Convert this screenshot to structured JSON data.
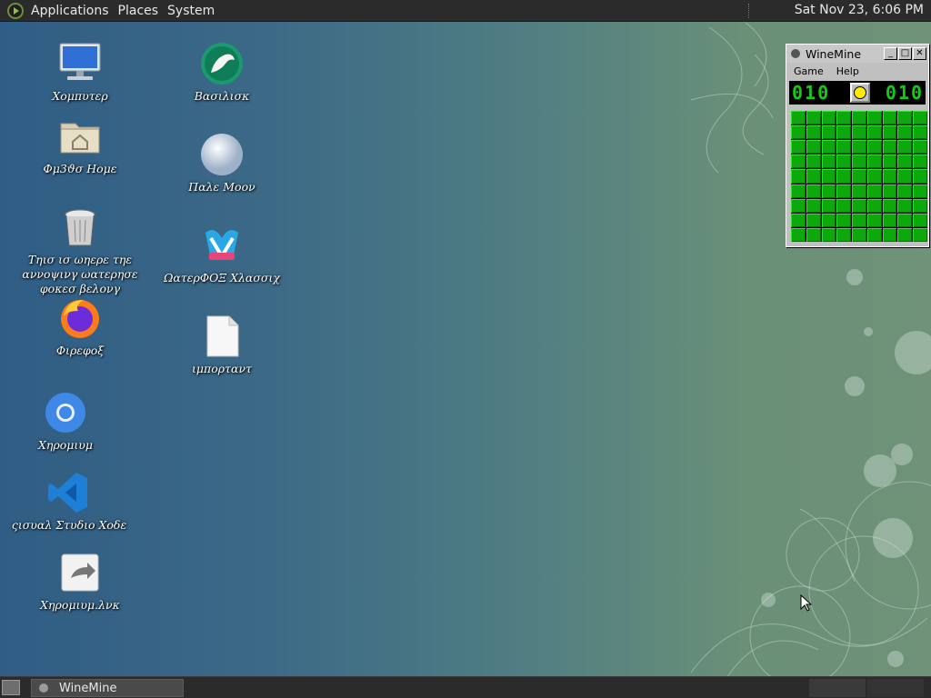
{
  "top_panel": {
    "menus": [
      "Applications",
      "Places",
      "System"
    ],
    "clock": "Sat Nov 23,  6:06 PM"
  },
  "desktop_icons": [
    {
      "label": "Χομπυτερ",
      "icon": "computer-icon"
    },
    {
      "label": "Φμ3ϑσ Ηομε",
      "icon": "home-folder-icon"
    },
    {
      "label": "Τηισ ισ ωηερε τηε αννοψινγ ωατερησε φοκεσ βελονγ",
      "icon": "trash-icon"
    },
    {
      "label": "Φιρεφοξ",
      "icon": "firefox-icon"
    },
    {
      "label": "Χηρομιυμ",
      "icon": "chromium-icon"
    },
    {
      "label": "ςισυαλ Στυδιο Χοδε",
      "icon": "vscode-icon"
    },
    {
      "label": "Χηρομιυμ.λνκ",
      "icon": "shortcut-icon"
    },
    {
      "label": "Βασιλισκ",
      "icon": "basilisk-icon"
    },
    {
      "label": "Παλε Μοον",
      "icon": "pale-moon-icon"
    },
    {
      "label": "ΩατερΦΟΞ Χλασσιχ",
      "icon": "waterfox-icon"
    },
    {
      "label": "ιμπορταντ",
      "icon": "text-file-icon"
    }
  ],
  "winemine": {
    "title": "WineMine",
    "menu": [
      "Game",
      "Help"
    ],
    "mines_left": "010",
    "timer": "010",
    "grid": {
      "rows": 9,
      "cols": 9
    }
  },
  "taskbar": {
    "tasks": [
      "WineMine"
    ]
  }
}
